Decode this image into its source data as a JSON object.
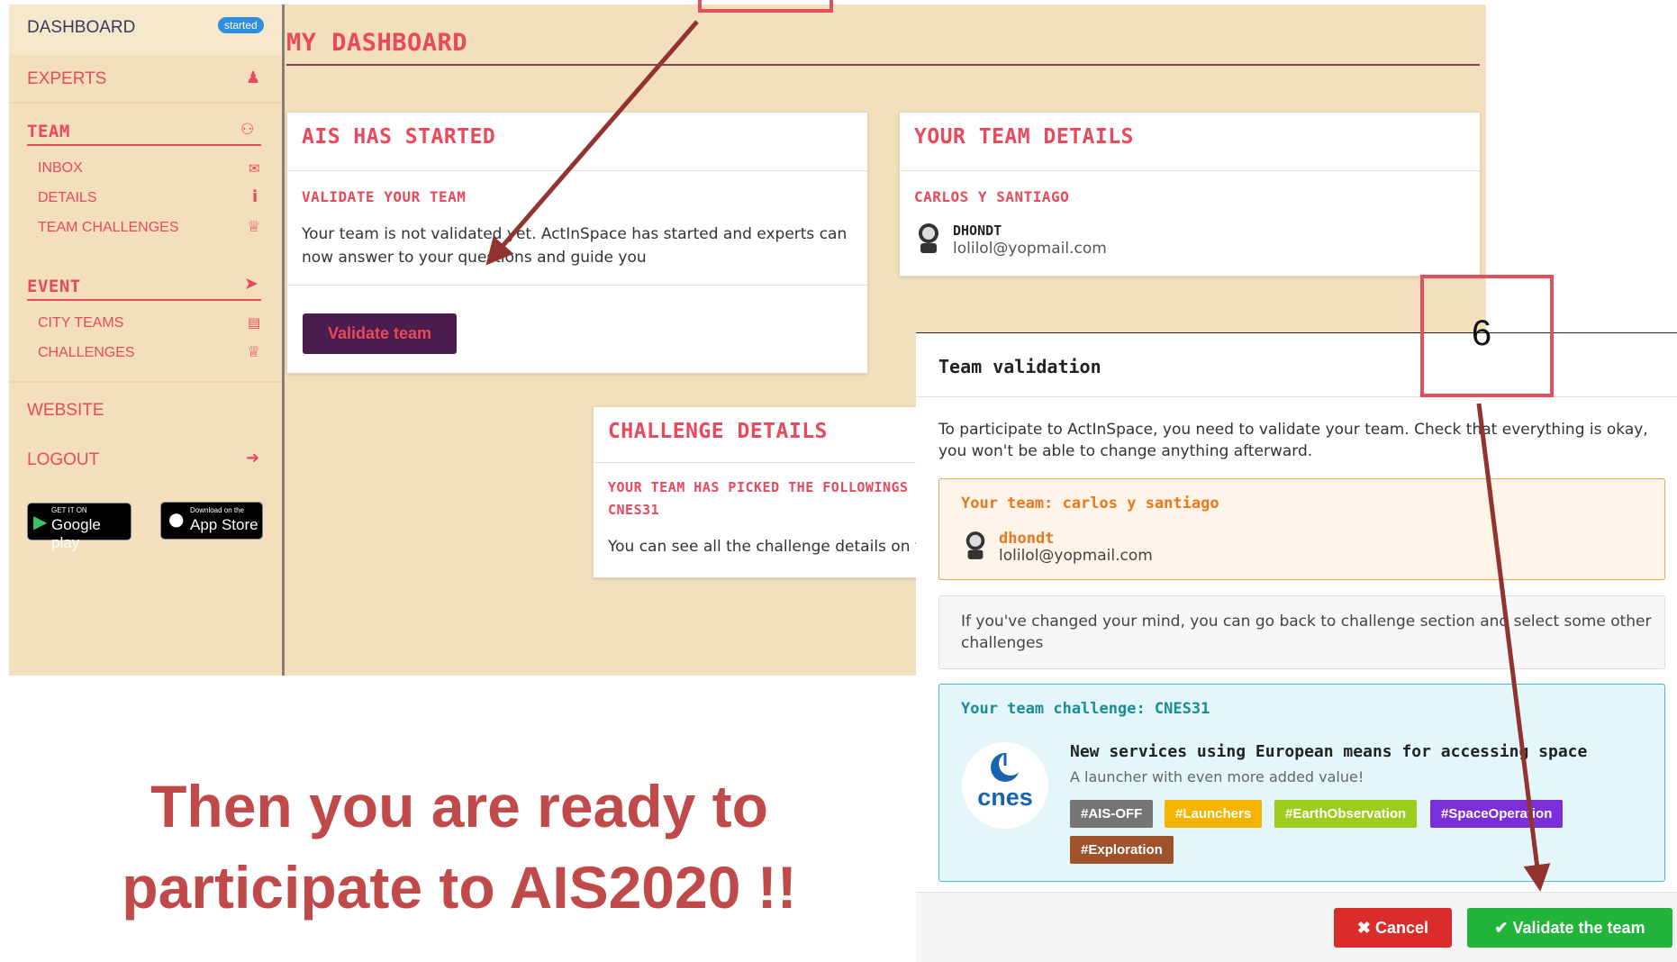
{
  "sidebar": {
    "dashboard": "DASHBOARD",
    "started_badge": "started",
    "experts": "EXPERTS",
    "team": "TEAM",
    "inbox": "INBOX",
    "details": "DETAILS",
    "team_challenges": "TEAM CHALLENGES",
    "event": "EVENT",
    "city_teams": "CITY TEAMS",
    "challenges": "CHALLENGES",
    "website": "WEBSITE",
    "logout": "LOGOUT",
    "google_play_small": "GET IT ON",
    "google_play": "Google play",
    "app_store_small": "Download on the",
    "app_store": "App Store"
  },
  "dashboard": {
    "title": "MY DASHBOARD",
    "ais_card": {
      "title": "AIS HAS STARTED",
      "subtitle": "VALIDATE YOUR TEAM",
      "text": "Your team is not validated yet. ActInSpace has started and experts can now answer to your questions and guide you",
      "button": "Validate team"
    },
    "team_card": {
      "title": "YOUR TEAM DETAILS",
      "team_name": "CARLOS Y SANTIAGO",
      "member_name": "DHONDT",
      "member_email": "lolilol@yopmail.com"
    },
    "challenge_card": {
      "title": "CHALLENGE DETAILS",
      "subtitle_line1": "YOUR TEAM HAS PICKED THE FOLLOWINGS CHA",
      "subtitle_line2": "CNES31",
      "text": "You can see all the challenge details on t"
    }
  },
  "modal": {
    "title": "Team validation",
    "intro": "To participate to ActInSpace, you need to validate your team. Check that everything is okay, you won't be able to change anything afterward.",
    "team_label": "Your team: carlos y santiago",
    "member_name": "dhondt",
    "member_email": "lolilol@yopmail.com",
    "change_mind": "If you've changed your mind, you can go back to challenge section and select some other challenges",
    "challenge_label": "Your team challenge: CNES31",
    "challenge_title": "New services using European means for accessing space",
    "challenge_subtitle": "A launcher with even more added value!",
    "cnes_logo": "cnes",
    "tags": [
      "#AIS-OFF",
      "#Launchers",
      "#EarthObservation",
      "#SpaceOperation",
      "#Exploration"
    ],
    "cancel": "Cancel",
    "validate": "Validate the team"
  },
  "annotation": {
    "step_number": "6",
    "caption_line1": "Then you are ready to",
    "caption_line2": "participate to AIS2020 !!",
    "colors": {
      "arrow": "#93332f",
      "highlight": "#e0505f",
      "caption": "#c0494a"
    }
  },
  "colors": {
    "accent": "#e8495b",
    "beige": "#f3dfbb",
    "dark_button": "#4b1d4f",
    "cancel": "#db2c2c",
    "validate": "#22b33a",
    "tag_grey": "#757575",
    "tag_yellow": "#f5b400",
    "tag_lime": "#9ccc1c",
    "tag_purple": "#7b2fd8",
    "tag_brown": "#a0522d"
  }
}
